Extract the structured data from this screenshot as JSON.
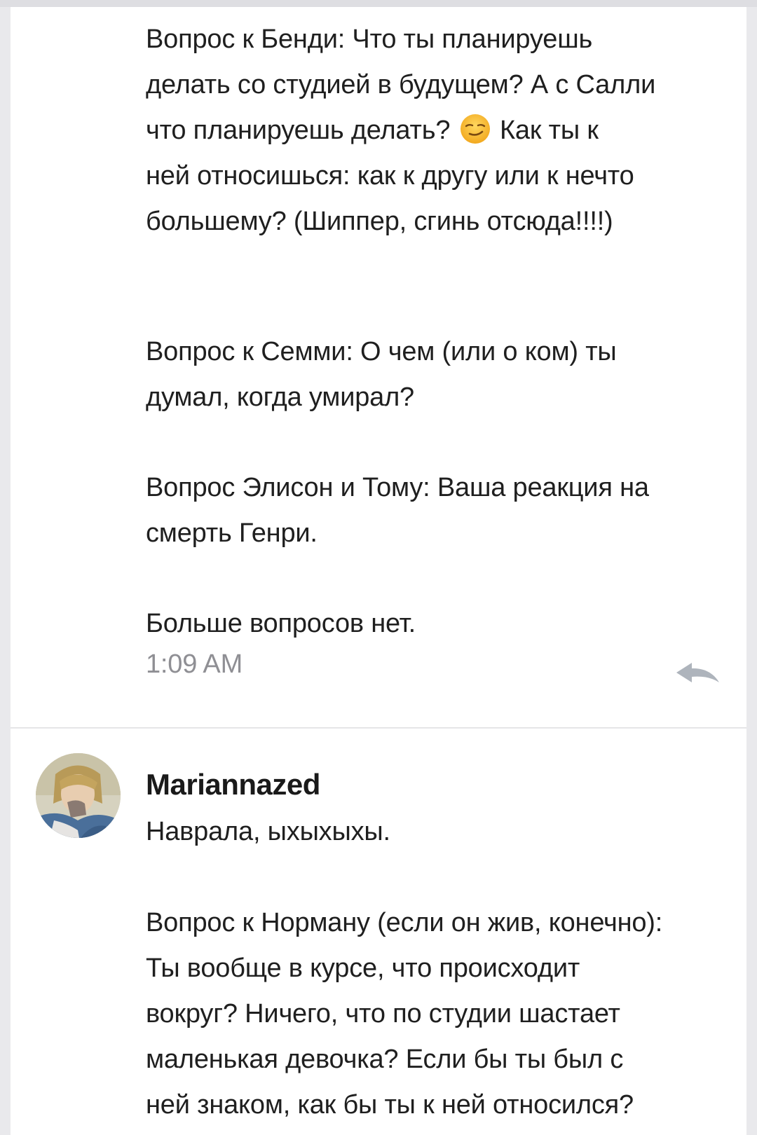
{
  "comment_1": {
    "q_bendy_before_emoji": "Вопрос к Бенди: Что ты планируешь\nделать со студией в будущем? А с Салли\nчто планируешь делать? ",
    "emoji": "smirking-face",
    "q_bendy_after_emoji": " Как ты к\nней относишься: как к другу или к нечто\nбольшему? (Шиппер, сгинь отсюда!!!!)",
    "q_sammy": "Вопрос к Семми: О чем (или о ком) ты\nдумал, когда умирал?",
    "q_alison_tom": "Вопрос Элисон и Тому: Ваша реакция на\nсмерть Генри.",
    "no_more": "Больше вопросов нет.",
    "timestamp": "1:09 AM",
    "reply_icon": "reply-arrow-icon"
  },
  "comment_2": {
    "avatar": "user-avatar",
    "username": "Mariannazed",
    "text": "Наврала, ыхыхыхы.\n\nВопрос к Норману (если он жив, конечно):\nТы вообще в курсе, что происходит\nвокруг? Ничего, что по студии шастает\nмаленькая девочка? Если бы ты был с\nней знаком, как бы ты к ней относился?"
  },
  "colors": {
    "background": "#e9e9ec",
    "card": "#ffffff",
    "text": "#1f1f1f",
    "timestamp": "#8f8f94",
    "reply_icon": "#aeb4bc"
  }
}
